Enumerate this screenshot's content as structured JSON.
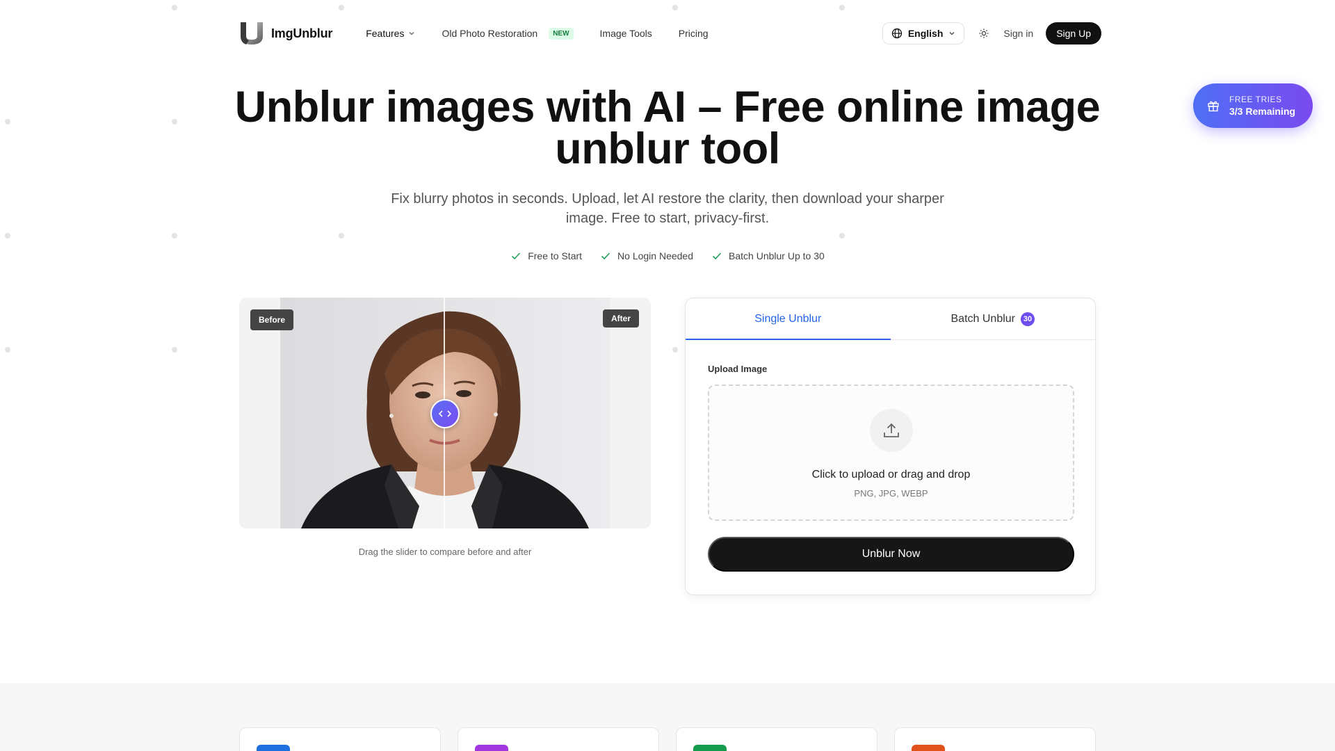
{
  "brand": {
    "name": "ImgUnblur"
  },
  "nav": {
    "features": "Features",
    "old_photo": "Old Photo Restoration",
    "new_badge": "NEW",
    "image_tools": "Image Tools",
    "pricing": "Pricing",
    "language": "English",
    "sign_in": "Sign in",
    "sign_up": "Sign Up"
  },
  "free_tries": {
    "label": "FREE TRIES",
    "remaining": "3/3 Remaining"
  },
  "hero": {
    "title": "Unblur images with AI – Free online image unblur tool",
    "subtitle": "Fix blurry photos in seconds. Upload, let AI restore the clarity, then download your sharper image. Free to start, privacy-first.",
    "checks": [
      "Free to Start",
      "No Login Needed",
      "Batch Unblur Up to 30"
    ]
  },
  "compare": {
    "before": "Before",
    "after": "After",
    "caption": "Drag the slider to compare before and after",
    "slider_position": 0.5
  },
  "upload_card": {
    "tabs": [
      {
        "label": "Single Unblur",
        "active": true
      },
      {
        "label": "Batch Unblur",
        "badge": "30",
        "active": false
      }
    ],
    "upload_label": "Upload Image",
    "drop_main": "Click to upload or drag and drop",
    "drop_formats": "PNG, JPG, WEBP",
    "cta": "Unblur Now"
  },
  "feature_icon_colors": [
    "#1e6fe0",
    "#a237e0",
    "#139a4c",
    "#e0521b"
  ],
  "colors": {
    "accent": "#2563eb",
    "gradient_start": "#4f6ff5",
    "gradient_end": "#7a4af0"
  }
}
